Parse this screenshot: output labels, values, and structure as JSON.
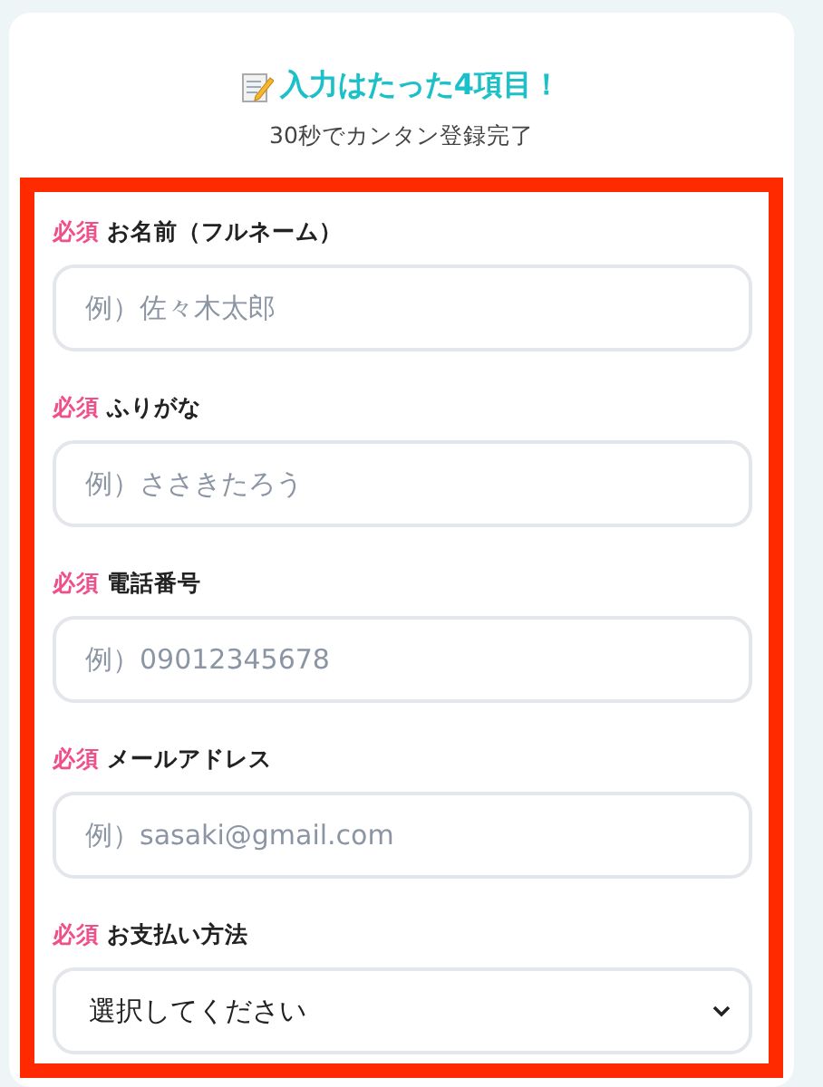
{
  "header": {
    "title": "入力はたった4項目！",
    "subtitle": "30秒でカンタン登録完了"
  },
  "fields": [
    {
      "kind": "text",
      "badge": "必須",
      "label": "お名前（フルネーム）",
      "placeholder": "例）佐々木太郎"
    },
    {
      "kind": "text",
      "badge": "必須",
      "label": "ふりがな",
      "placeholder": "例）ささきたろう"
    },
    {
      "kind": "text",
      "badge": "必須",
      "label": "電話番号",
      "placeholder": "例）09012345678"
    },
    {
      "kind": "text",
      "badge": "必須",
      "label": "メールアドレス",
      "placeholder": "例）sasaki@gmail.com"
    },
    {
      "kind": "select",
      "badge": "必須",
      "label": "お支払い方法",
      "value": "選択してください"
    }
  ]
}
